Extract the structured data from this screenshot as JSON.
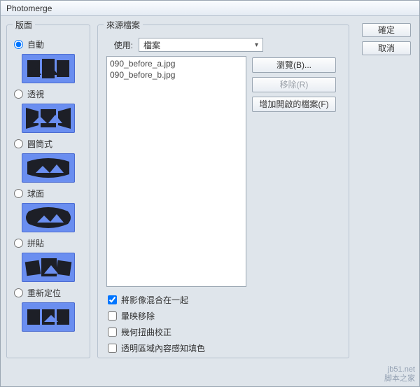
{
  "window": {
    "title": "Photomerge"
  },
  "layout": {
    "legend": "版面",
    "options": [
      {
        "key": "auto",
        "label": "自動",
        "checked": true
      },
      {
        "key": "perspective",
        "label": "透視",
        "checked": false
      },
      {
        "key": "cylindrical",
        "label": "圓筒式",
        "checked": false
      },
      {
        "key": "spherical",
        "label": "球面",
        "checked": false
      },
      {
        "key": "collage",
        "label": "拼貼",
        "checked": false
      },
      {
        "key": "reposition",
        "label": "重新定位",
        "checked": false
      }
    ]
  },
  "source": {
    "legend": "來源檔案",
    "use_label": "使用:",
    "use_value": "檔案",
    "files": [
      "090_before_a.jpg",
      "090_before_b.jpg"
    ],
    "buttons": {
      "browse": "瀏覽(B)...",
      "remove": "移除(R)",
      "add_open": "增加開啟的檔案(F)"
    },
    "checks": {
      "blend": {
        "label": "將影像混合在一起",
        "checked": true
      },
      "vignette": {
        "label": "暈映移除",
        "checked": false
      },
      "geodist": {
        "label": "幾何扭曲校正",
        "checked": false
      },
      "caf": {
        "label": "透明區域內容感知填色",
        "checked": false
      }
    }
  },
  "dialog": {
    "ok": "確定",
    "cancel": "取消"
  },
  "watermark": {
    "line1": "jb51.net",
    "line2": "脚本之家"
  }
}
